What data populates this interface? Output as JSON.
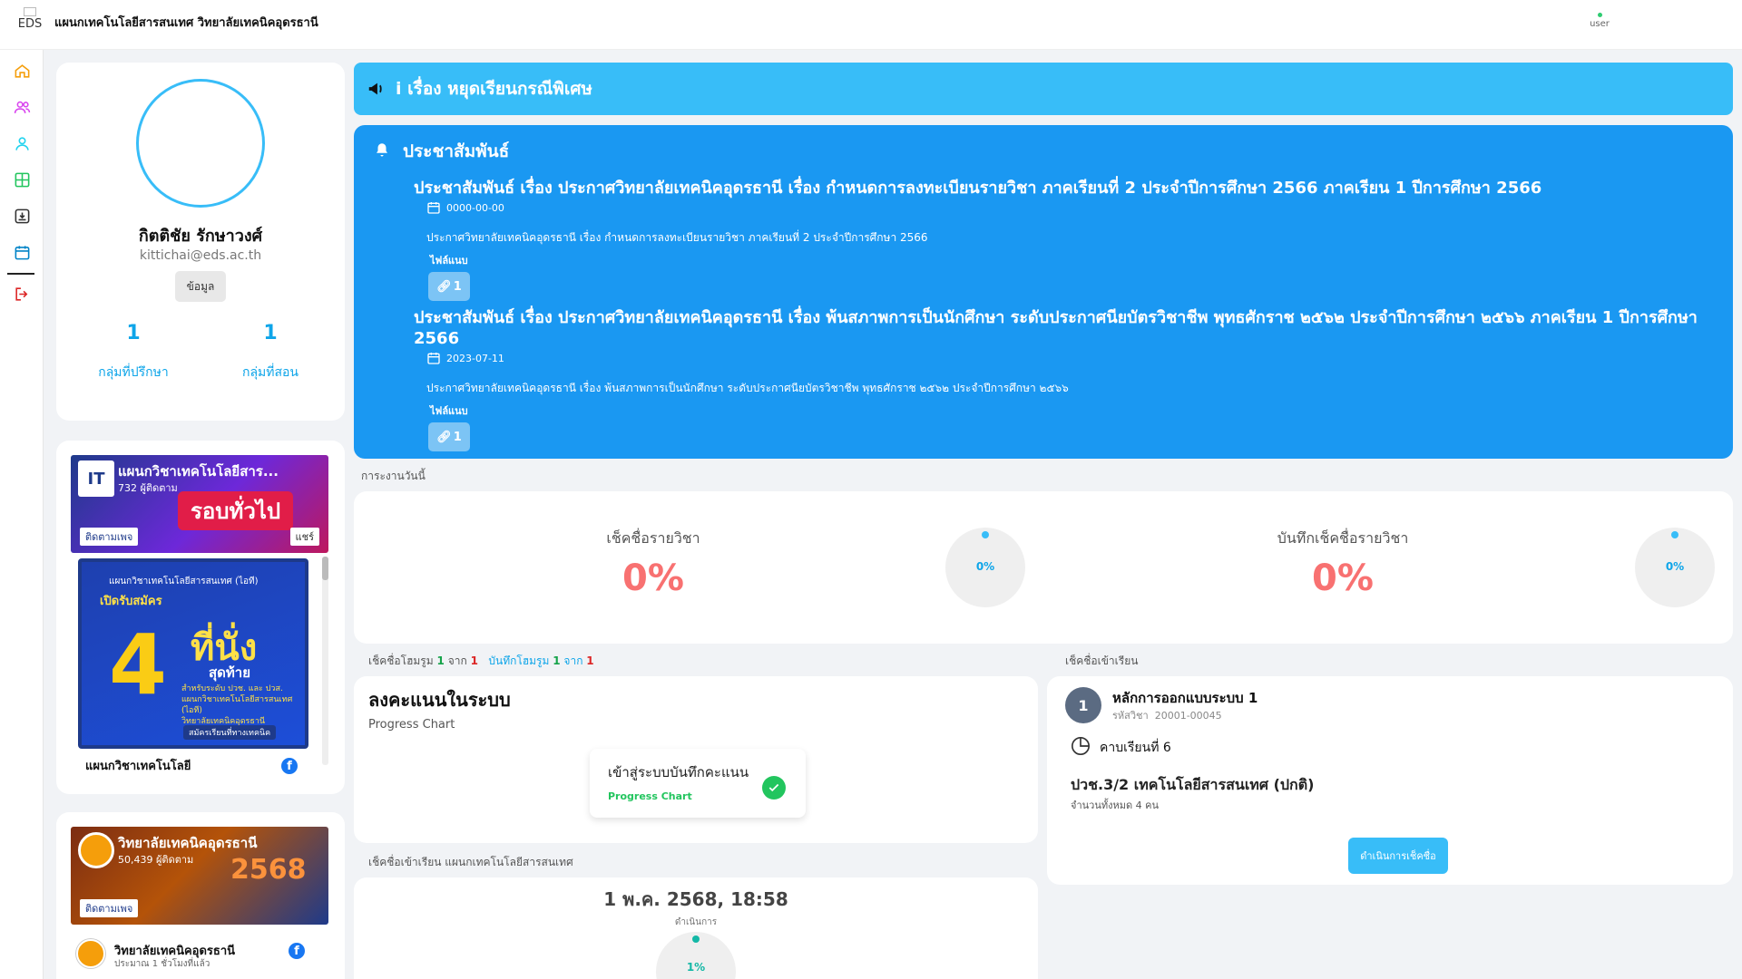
{
  "header": {
    "logo_alt": "EDS",
    "title": "แผนกเทคโนโลยีสารสนเทศ วิทยาลัยเทคนิคอุดรธานี",
    "user_alt": "user"
  },
  "sidebar": {
    "items": [
      "home-icon",
      "users-icon",
      "user-icon",
      "grid-icon",
      "download-box-icon",
      "calendar-icon"
    ],
    "logout": "logout-icon"
  },
  "profile": {
    "name": "กิตติชัย รักษาวงศ์",
    "email": "kittichai@eds.ac.th",
    "info_button": "ข้อมูล",
    "stats": [
      {
        "value": "1",
        "label": "กลุ่มที่ปรึกษา"
      },
      {
        "value": "1",
        "label": "กลุ่มที่สอน"
      }
    ]
  },
  "fb_widgets": [
    {
      "page_name": "แผนกวิชาเทคโนโลยีสาร...",
      "followers": "732 ผู้ติดตาม",
      "follow": "ติดตามเพจ",
      "share": "แชร์",
      "badge": "รอบทั่วไป",
      "poster": {
        "org": "แผนกวิชาเทคโนโลยีสารสนเทศ (ไอที)",
        "headline": "เปิดรับสมัคร",
        "number": "4",
        "seats": "ที่นั่ง",
        "last": "สุดท้าย",
        "detail1": "สำหรับระดับ ปวช. และ ปวส.",
        "detail2": "แผนกวิชาเทคโนโลยีสารสนเทศ (ไอที)",
        "detail3": "วิทยาลัยเทคนิคอุดรธานี",
        "apply": "สมัครเรียนที่ทางเทคนิค"
      },
      "footer_name": "แผนกวิชาเทคโนโลยี"
    },
    {
      "page_name": "วิทยาลัยเทคนิคอุดรธานี",
      "followers": "50,439 ผู้ติดตาม",
      "follow": "ติดตามเพจ",
      "year": "2568",
      "row_name": "วิทยาลัยเทคนิคอุดรธานี",
      "row_time": "ประมาณ 1 ชั่วโมงที่แล้ว"
    }
  ],
  "announcement": {
    "title": "เรื่อง หยุดเรียนกรณีพิเศษ"
  },
  "news": {
    "heading": "ประชาสัมพันธ์",
    "attach_label": "ไฟล์แนบ",
    "items": [
      {
        "title": "ประชาสัมพันธ์ เรื่อง ประกาศวิทยาลัยเทคนิคอุดรธานี เรื่อง กำหนดการลงทะเบียนรายวิชา ภาคเรียนที่ 2 ประจำปีการศึกษา 2566 ภาคเรียน 1 ปีการศึกษา 2566",
        "date": "0000-00-00",
        "body": "ประกาศวิทยาลัยเทคนิคอุดรธานี เรื่อง กำหนดการลงทะเบียนรายวิชา ภาคเรียนที่ 2 ประจำปีการศึกษา 2566",
        "files": "1"
      },
      {
        "title": "ประชาสัมพันธ์ เรื่อง ประกาศวิทยาลัยเทคนิคอุดรธานี เรื่อง พ้นสภาพการเป็นนักศึกษา ระดับประกาศนียบัตรวิชาชีพ พุทธศักราช ๒๕๖๒ ประจำปีการศึกษา ๒๕๖๖ ภาคเรียน 1 ปีการศึกษา 2566",
        "date": "2023-07-11",
        "body": "ประกาศวิทยาลัยเทคนิคอุดรธานี เรื่อง พ้นสภาพการเป็นนักศึกษา ระดับประกาศนียบัตรวิชาชีพ พุทธศักราช ๒๕๖๒ ประจำปีการศึกษา ๒๕๖๖",
        "files": "1"
      }
    ]
  },
  "today": {
    "section_label": "การะงานวันนี้",
    "kpis": [
      {
        "label": "เช็คชื่อรายวิชา",
        "percent": "0%",
        "gauge": "0%"
      },
      {
        "label": "บันทึกเช็คชื่อรายวิชา",
        "percent": "0%",
        "gauge": "0%"
      }
    ]
  },
  "homeroom": {
    "check_label": "เช็คชื่อโฮมรูม",
    "check_done": "1",
    "of": "จาก",
    "check_total": "1",
    "record_label": "บันทึกโฮมรูม",
    "record_done": "1",
    "record_total": "1"
  },
  "scores": {
    "title": "ลงคะแนนในระบบ",
    "subtitle": "Progress Chart",
    "card_title": "เข้าสู่ระบบบันทึกคะแนน",
    "card_sub": "Progress Chart"
  },
  "checkin": {
    "section_label": "เช็คชื่อเข้าเรียน",
    "number": "1",
    "course": "หลักการออกแบบระบบ 1",
    "code_label": "รหัสวิชา",
    "code": "20001-00045",
    "period": "คาบเรียนที่ 6",
    "group": "ปวช.3/2 เทคโนโลยีสารสนเทศ (ปกติ)",
    "count": "จำนวนทั้งหมด 4 คน",
    "button": "ดำเนินการเช็คชื่อ"
  },
  "dept": {
    "section_label": "เช็คชื่อเข้าเรียน แผนกเทคโนโลยีสารสนเทศ",
    "datetime": "1 พ.ค. 2568, 18:58",
    "status": "ดำเนินการ",
    "gauge": "1%"
  },
  "colors": {
    "accent": "#38bdf8",
    "news_bg": "#1a98f2",
    "kpi_red": "#f87171",
    "success": "#22c55e"
  }
}
